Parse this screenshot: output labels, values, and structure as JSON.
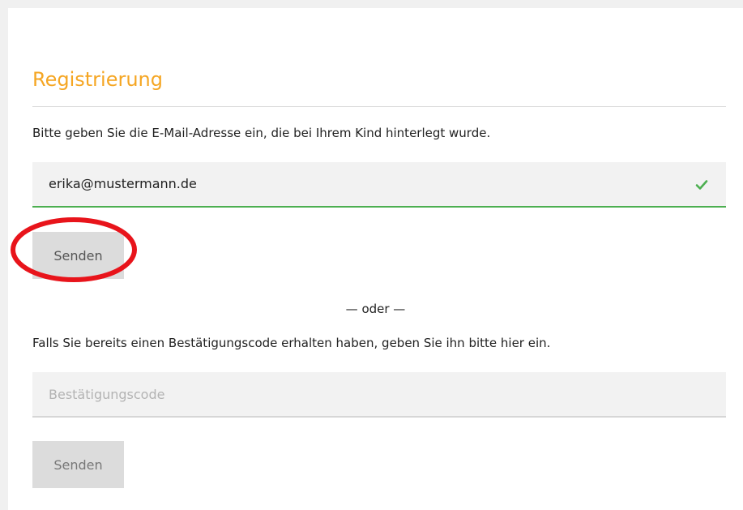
{
  "registration": {
    "title": "Registrierung",
    "intro": "Bitte geben Sie die E-Mail-Adresse ein, die bei Ihrem Kind hinterlegt wurde.",
    "email_value": "erika@mustermann.de",
    "send_label": "Senden",
    "or_separator": "— oder —",
    "code_intro": "Falls Sie bereits einen Bestätigungscode erhalten haben, geben Sie ihn bitte hier ein.",
    "code_placeholder": "Bestätigungscode",
    "code_send_label": "Senden"
  },
  "icons": {
    "valid": "check-icon"
  },
  "colors": {
    "title": "#f5a623",
    "valid": "#4caf50",
    "highlight": "#e8141b"
  }
}
